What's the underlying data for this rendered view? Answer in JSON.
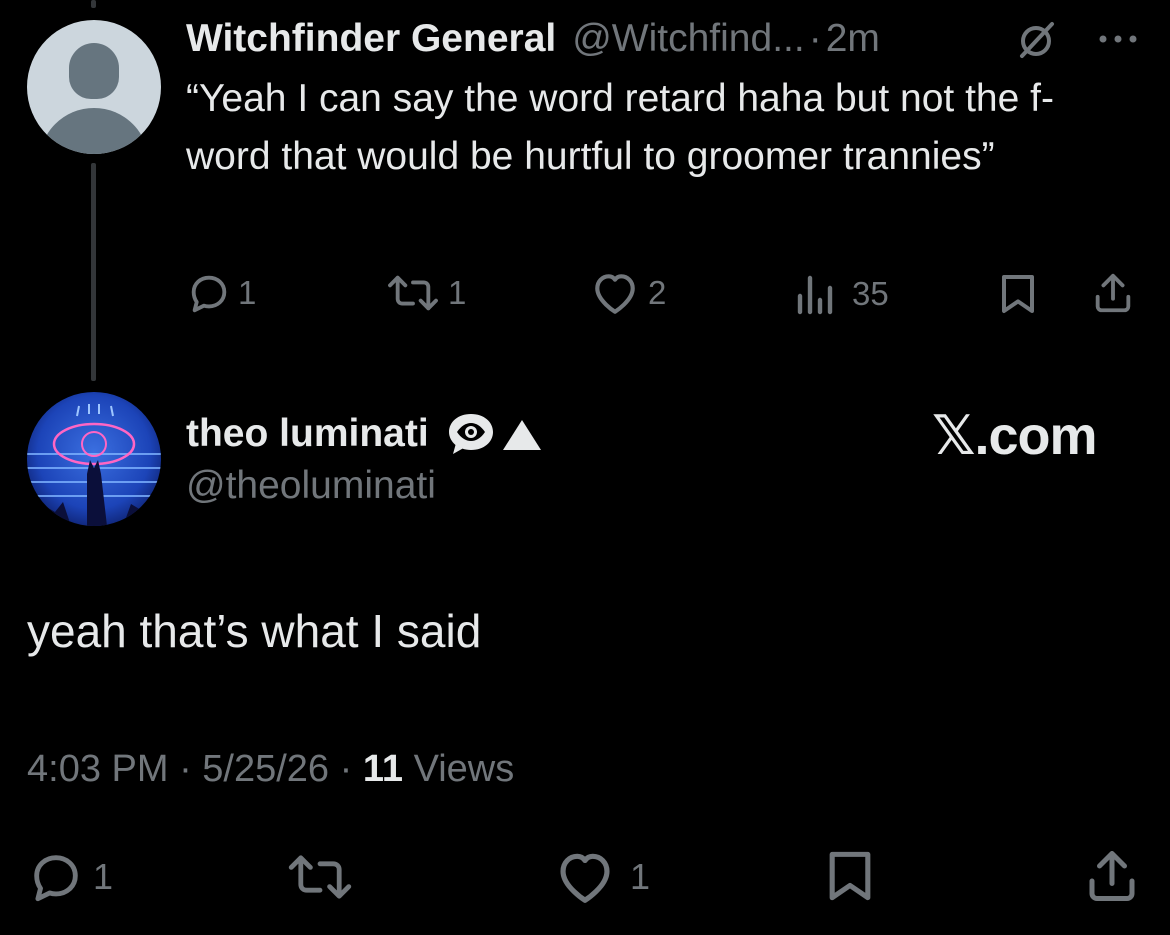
{
  "parent_tweet": {
    "display_name": "Witchfinder General",
    "handle": "@Witchfind...",
    "separator": "·",
    "time": "2m",
    "text": "“Yeah I can say the word retard haha but not the f-word that would be hurtful to groomer trannies”",
    "actions": {
      "replies": "1",
      "reposts": "1",
      "likes": "2",
      "views": "35"
    }
  },
  "main_tweet": {
    "display_name": "theo luminati",
    "name_emoji": "👁️▲",
    "handle": "@theoluminati",
    "watermark": "𝕏.com",
    "text": "yeah that’s what I said",
    "timestamp": "4:03 PM · 5/25/26 · ",
    "views_count": "11",
    "views_label": " Views",
    "actions": {
      "replies": "1",
      "likes": "1"
    }
  },
  "colors": {
    "background": "#000000",
    "primary_text": "#e7e9ea",
    "secondary_text": "#71767b",
    "thread_line": "#333639"
  }
}
